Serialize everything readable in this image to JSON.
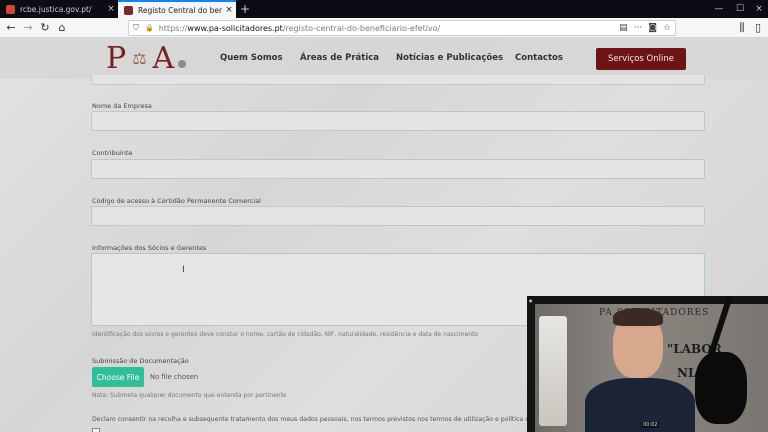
{
  "browser": {
    "tabs": [
      {
        "label": "rcbe.justica.gov.pt/",
        "close": "×"
      },
      {
        "label": "Registo Central do beneficiário",
        "close": "×"
      }
    ],
    "new_tab": "+",
    "url": {
      "proto": "https://",
      "host": "www.pa-solicitadores.pt",
      "path": "/registo-central-do-beneficiario-efetivo/",
      "ellipsis": "···"
    },
    "window_controls": {
      "minimize": "—",
      "maximize": "☐",
      "close": "×"
    }
  },
  "site": {
    "logo": {
      "left": "P",
      "right": "A"
    },
    "menu": [
      "Quem Somos",
      "Áreas de Prática",
      "Notícias e Publicações",
      "Contactos"
    ],
    "cta": "Serviços Online"
  },
  "form": {
    "fields": [
      {
        "label": "Nome da Empresa",
        "value": ""
      },
      {
        "label": "Contribuinte",
        "value": ""
      },
      {
        "label": "Código de acesso à Certidão Permanente Comercial",
        "value": ""
      }
    ],
    "textarea": {
      "label": "Informações dos Sócios e Gerentes",
      "help": "Identificação dos sócios e gerentes deve constar o nome, cartão de cidadão, NIF, naturalidade, residência e data de nascimento"
    },
    "upload": {
      "label": "Submissão de Documentação",
      "button": "Choose File",
      "status": "No file chosen",
      "help": "Nota: Submeta qualquer documento que entenda por pertinente"
    },
    "consent": {
      "text": "Declaro consentir na recolha e subsequente tratamento dos meus dados pessoais, nos termos previstos nos termos de utilização e política de privacidade.",
      "required_mark": "*"
    }
  },
  "webcam": {
    "sign": "PA SOLICITADORES",
    "quote_line1": "\"LABOR",
    "quote_line2": "NIA V",
    "timestamp": "00:02"
  }
}
